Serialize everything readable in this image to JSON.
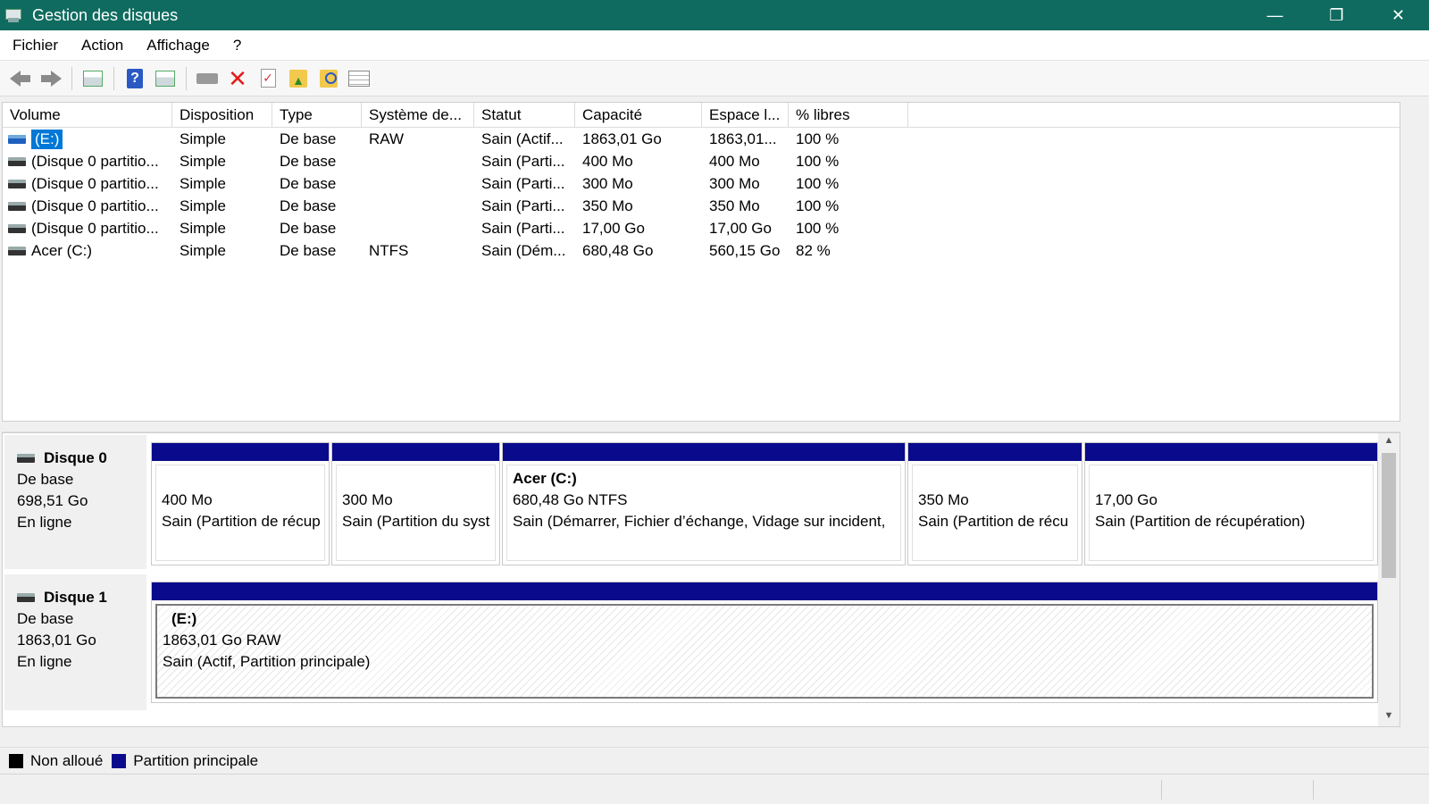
{
  "window": {
    "title": "Gestion des disques",
    "minimize": "—",
    "maximize": "❐",
    "close": "✕"
  },
  "menu": [
    "Fichier",
    "Action",
    "Affichage",
    "?"
  ],
  "columns": [
    "Volume",
    "Disposition",
    "Type",
    "Système de...",
    "Statut",
    "Capacité",
    "Espace l...",
    "% libres"
  ],
  "volumes": [
    {
      "volume": "(E:)",
      "disposition": "Simple",
      "type": "De base",
      "fs": "RAW",
      "statut": "Sain (Actif...",
      "capacite": "1863,01 Go",
      "espace": "1863,01...",
      "libres": "100 %",
      "selected": true
    },
    {
      "volume": "(Disque 0 partitio...",
      "disposition": "Simple",
      "type": "De base",
      "fs": "",
      "statut": "Sain (Parti...",
      "capacite": "400 Mo",
      "espace": "400 Mo",
      "libres": "100 %"
    },
    {
      "volume": "(Disque 0 partitio...",
      "disposition": "Simple",
      "type": "De base",
      "fs": "",
      "statut": "Sain (Parti...",
      "capacite": "300 Mo",
      "espace": "300 Mo",
      "libres": "100 %"
    },
    {
      "volume": "(Disque 0 partitio...",
      "disposition": "Simple",
      "type": "De base",
      "fs": "",
      "statut": "Sain (Parti...",
      "capacite": "350 Mo",
      "espace": "350 Mo",
      "libres": "100 %"
    },
    {
      "volume": "(Disque 0 partitio...",
      "disposition": "Simple",
      "type": "De base",
      "fs": "",
      "statut": "Sain (Parti...",
      "capacite": "17,00 Go",
      "espace": "17,00 Go",
      "libres": "100 %"
    },
    {
      "volume": "Acer (C:)",
      "disposition": "Simple",
      "type": "De base",
      "fs": "NTFS",
      "statut": "Sain (Dém...",
      "capacite": "680,48 Go",
      "espace": "560,15 Go",
      "libres": "82 %"
    }
  ],
  "disks": [
    {
      "name": "Disque 0",
      "kind": "De base",
      "size": "698,51 Go",
      "state": "En ligne",
      "partitions": [
        {
          "name": "",
          "size": "400 Mo",
          "status": "Sain (Partition de récup"
        },
        {
          "name": "",
          "size": "300 Mo",
          "status": "Sain (Partition du syst"
        },
        {
          "name": "Acer  (C:)",
          "size": "680,48 Go NTFS",
          "status": "Sain (Démarrer, Fichier d’échange, Vidage sur incident,"
        },
        {
          "name": "",
          "size": "350 Mo",
          "status": "Sain (Partition de récu"
        },
        {
          "name": "",
          "size": "17,00 Go",
          "status": "Sain (Partition de récupération)"
        }
      ]
    },
    {
      "name": "Disque 1",
      "kind": "De base",
      "size": "1863,01 Go",
      "state": "En ligne",
      "partitions": [
        {
          "name": "(E:)",
          "size": "1863,01 Go RAW",
          "status": "Sain (Actif, Partition principale)"
        }
      ]
    }
  ],
  "legend": [
    {
      "label": "Non alloué",
      "color": "#000000"
    },
    {
      "label": "Partition principale",
      "color": "#0a0a8c"
    }
  ],
  "colors": {
    "titlebar": "#0f6b5f",
    "selection": "#0078d7",
    "partition_bar": "#0a0a8c"
  }
}
